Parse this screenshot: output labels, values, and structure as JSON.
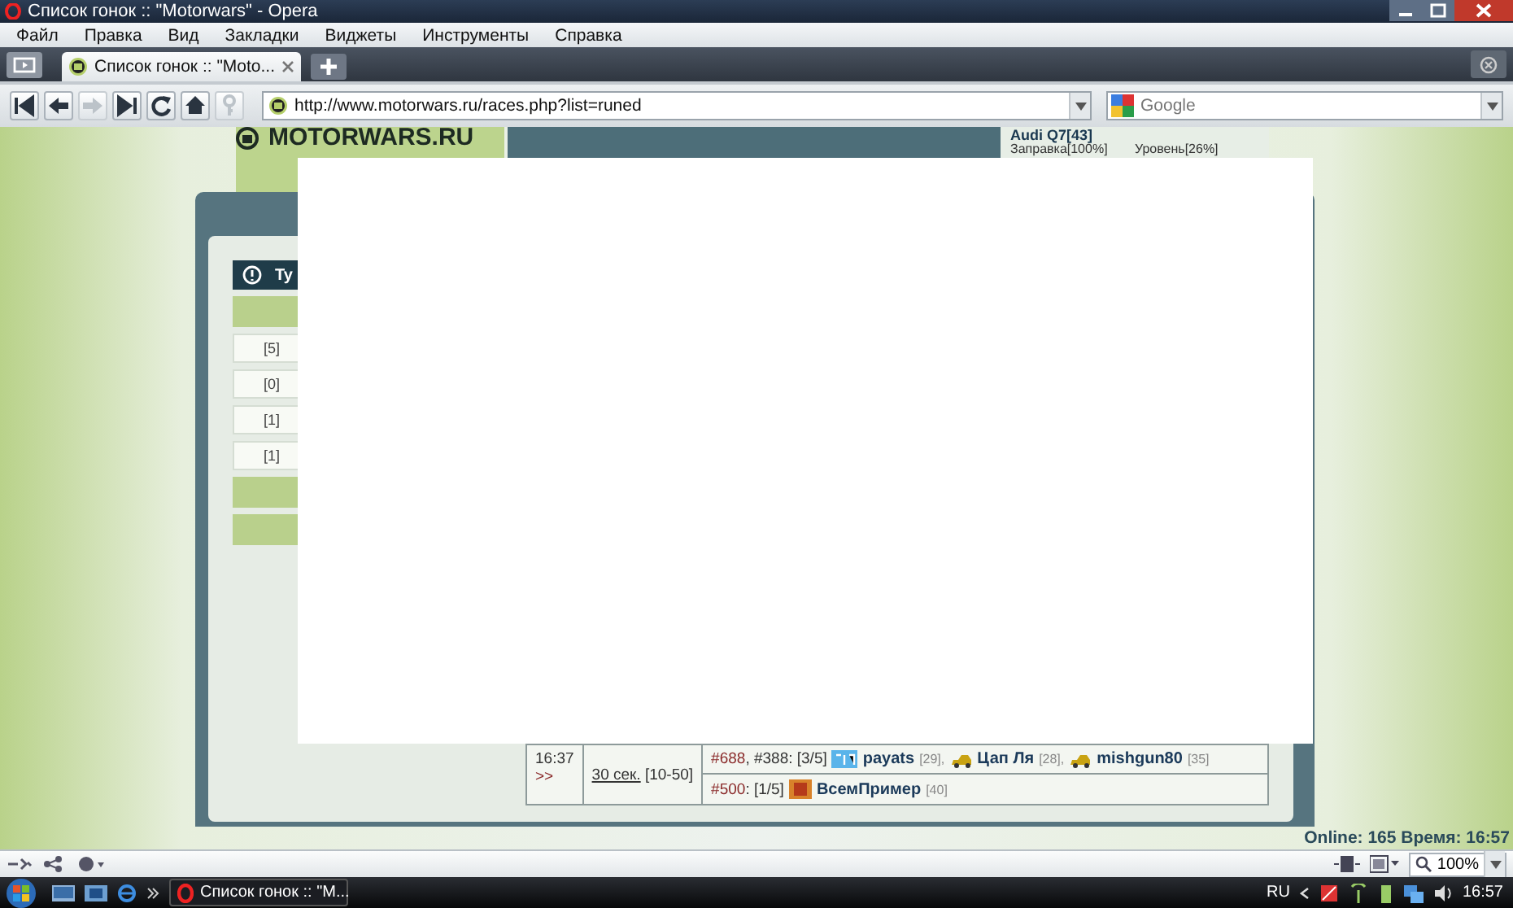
{
  "window": {
    "title": "Список гонок :: \"Motorwars\" - Opera"
  },
  "menu": [
    "Файл",
    "Правка",
    "Вид",
    "Закладки",
    "Виджеты",
    "Инструменты",
    "Справка"
  ],
  "tab": {
    "label": "Список гонок :: \"Moto..."
  },
  "toolbar": [
    {
      "kind": "first",
      "disabled": false
    },
    {
      "kind": "back",
      "disabled": false
    },
    {
      "kind": "forward",
      "disabled": true
    },
    {
      "kind": "last",
      "disabled": false
    },
    {
      "kind": "reload",
      "disabled": false
    },
    {
      "kind": "home",
      "disabled": false
    },
    {
      "kind": "key",
      "disabled": true
    }
  ],
  "address": {
    "value": "http://www.motorwars.ru/races.php?list=runed"
  },
  "search": {
    "placeholder": "Google"
  },
  "site": {
    "logo": "MOTORWARS.RU",
    "car": "Audi Q7[43]",
    "fuel": "Заправка[100%]",
    "level": "Уровень[26%]"
  },
  "left_table": {
    "header": "Ty",
    "rows": [
      {
        "kind": "group"
      },
      {
        "kind": "data",
        "text": "[5]"
      },
      {
        "kind": "data",
        "text": "[0]"
      },
      {
        "kind": "data",
        "text": "[1]"
      },
      {
        "kind": "data",
        "text": "[1]"
      },
      {
        "kind": "group"
      },
      {
        "kind": "group"
      }
    ]
  },
  "race": {
    "time": "16:37",
    "more": ">>",
    "duration": "30 сек.",
    "range": "[10-50]",
    "entries": [
      {
        "id": "#688",
        "info": ", #388: [3/5]",
        "racers": [
          {
            "kind": "clan",
            "name": "payats",
            "level": "[29]",
            "sep": ","
          },
          {
            "kind": "car",
            "name": "Цап Ля",
            "level": "[28]",
            "sep": ","
          },
          {
            "kind": "car",
            "name": "mishgun80",
            "level": "[35]"
          }
        ]
      },
      {
        "id": "#500",
        "info": ": [1/5]",
        "racers": [
          {
            "kind": "emblem",
            "name": "ВсемПример",
            "level": "[40]"
          }
        ]
      }
    ]
  },
  "site_status": "Online: 165  Время: 16:57",
  "zoom": "100%",
  "taskbar": {
    "task": "Список гонок :: \"M...",
    "language": "RU",
    "clock": "16:57"
  }
}
